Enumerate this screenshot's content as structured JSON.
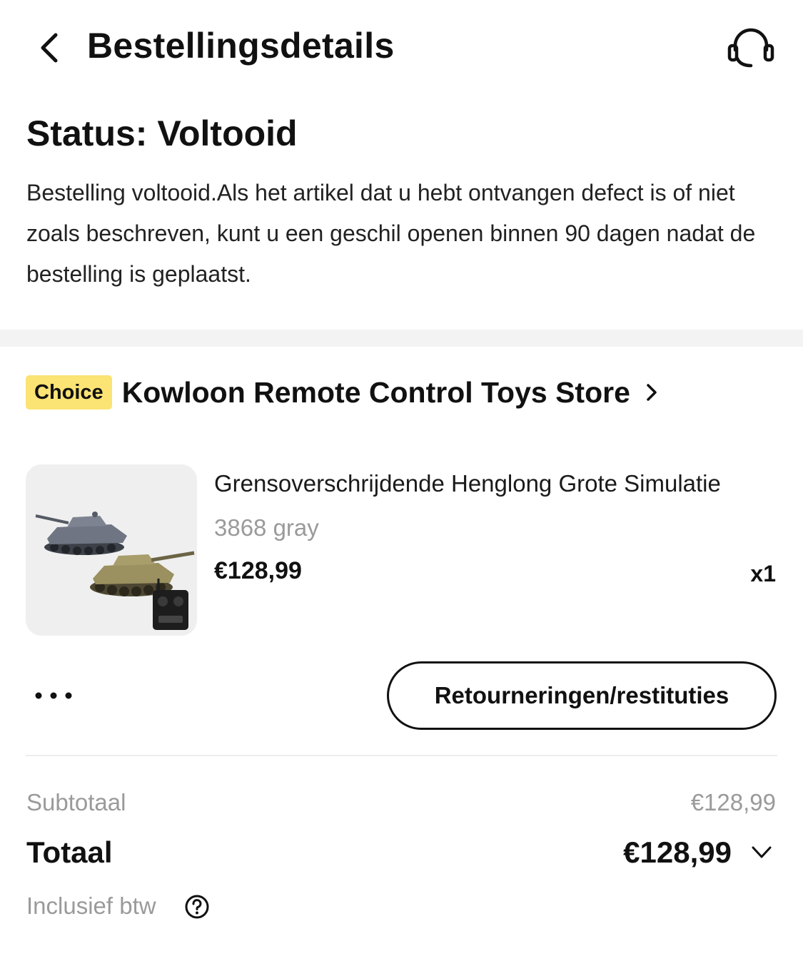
{
  "header": {
    "title": "Bestellingsdetails",
    "back_icon": "chevron-left-icon",
    "support_icon": "headset-icon"
  },
  "status": {
    "title": "Status: Voltooid",
    "description": "Bestelling voltooid.Als het artikel dat u hebt ontvangen defect is of niet zoals beschreven, kunt u een geschil openen binnen 90 dagen nadat de bestelling is geplaatst."
  },
  "store": {
    "badge": "Choice",
    "name": "Kowloon Remote Control Toys Store",
    "badge_color": "#fbe374"
  },
  "product": {
    "title": "Grensoverschrijdende Henglong Grote Simulatie",
    "variant": "3868 gray",
    "price": "€128,99",
    "quantity": "x1"
  },
  "actions": {
    "more_icon": "more-dots-icon",
    "return_label": "Retourneringen/restituties"
  },
  "summary": {
    "subtotal_label": "Subtotaal",
    "subtotal_value": "€128,99",
    "total_label": "Totaal",
    "total_value": "€128,99",
    "vat_label": "Inclusief btw"
  }
}
